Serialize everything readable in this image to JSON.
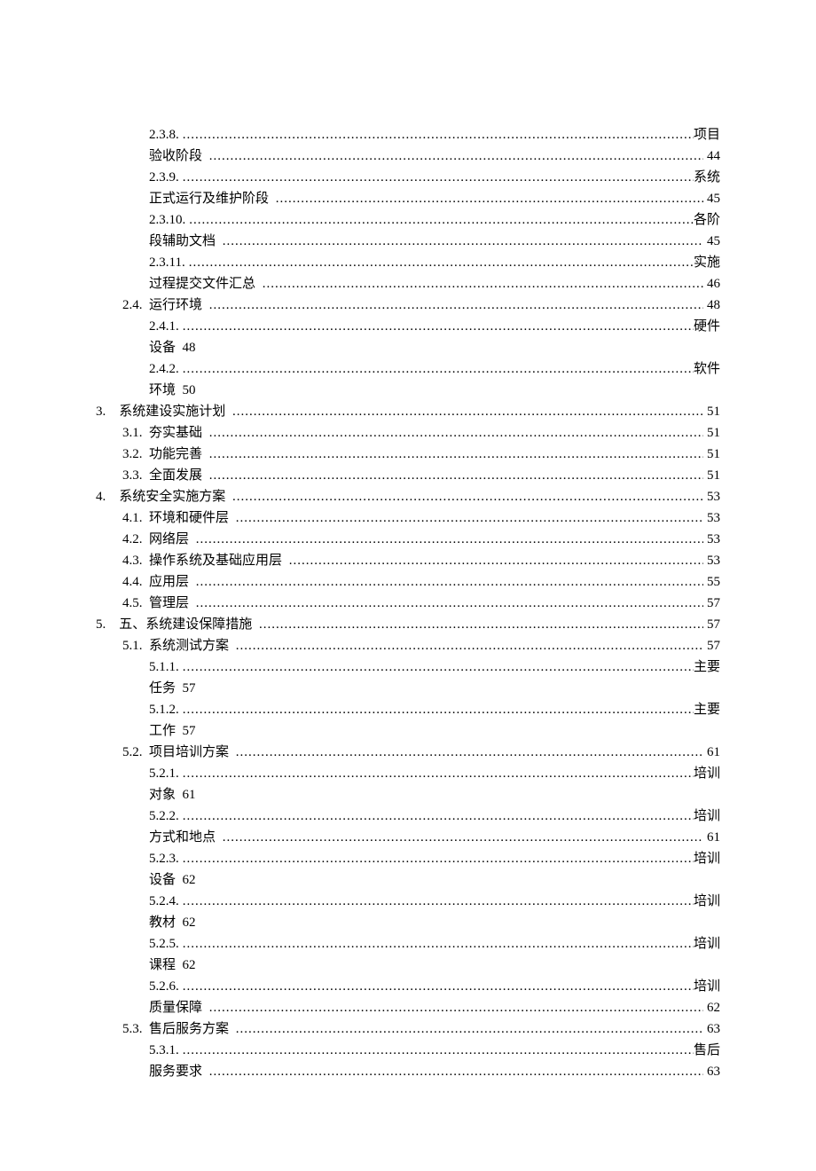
{
  "toc": [
    {
      "kind": "wrap-dots-page",
      "level": 3,
      "num": "2.3.8.",
      "title_tail": "项目",
      "cont": "验收阶段 ",
      "page": "44"
    },
    {
      "kind": "wrap-dots-page",
      "level": 3,
      "num": "2.3.9.",
      "title_tail": "系统",
      "cont": "正式运行及维护阶段 ",
      "page": "45"
    },
    {
      "kind": "wrap-dots-page",
      "level": 3,
      "num": "2.3.10.",
      "title_tail": "各阶",
      "cont": "段辅助文档 ",
      "page": "45"
    },
    {
      "kind": "wrap-dots-page",
      "level": 3,
      "num": "2.3.11.",
      "title_tail": "实施",
      "cont": "过程提交文件汇总 ",
      "page": "46"
    },
    {
      "kind": "single",
      "level": 2,
      "num": "2.4.  ",
      "title": "运行环境 ",
      "page": "48"
    },
    {
      "kind": "wrap-page-only",
      "level": 3,
      "num": "2.4.1.",
      "title_tail": "硬件",
      "cont_text": "设备  48"
    },
    {
      "kind": "wrap-page-only",
      "level": 3,
      "num": "2.4.2.",
      "title_tail": "软件",
      "cont_text": "环境  50"
    },
    {
      "kind": "single",
      "level": 1,
      "num": "3.    ",
      "title": "系统建设实施计划 ",
      "page": "51"
    },
    {
      "kind": "single",
      "level": 2,
      "num": "3.1.  ",
      "title": "夯实基础 ",
      "page": "51"
    },
    {
      "kind": "single",
      "level": 2,
      "num": "3.2.  ",
      "title": "功能完善 ",
      "page": "51"
    },
    {
      "kind": "single",
      "level": 2,
      "num": "3.3.  ",
      "title": "全面发展 ",
      "page": "51"
    },
    {
      "kind": "single",
      "level": 1,
      "num": "4.    ",
      "title": "系统安全实施方案 ",
      "page": "53"
    },
    {
      "kind": "single",
      "level": 2,
      "num": "4.1.  ",
      "title": "环境和硬件层 ",
      "page": "53"
    },
    {
      "kind": "single",
      "level": 2,
      "num": "4.2.  ",
      "title": "网络层 ",
      "page": "53"
    },
    {
      "kind": "single",
      "level": 2,
      "num": "4.3.  ",
      "title": "操作系统及基础应用层 ",
      "page": "53"
    },
    {
      "kind": "single",
      "level": 2,
      "num": "4.4.  ",
      "title": "应用层 ",
      "page": "55"
    },
    {
      "kind": "single",
      "level": 2,
      "num": "4.5.  ",
      "title": "管理层 ",
      "page": "57"
    },
    {
      "kind": "single",
      "level": 1,
      "num": "5.    ",
      "title": "五、系统建设保障措施 ",
      "page": "57"
    },
    {
      "kind": "single",
      "level": 2,
      "num": "5.1.  ",
      "title": "系统测试方案 ",
      "page": "57"
    },
    {
      "kind": "wrap-page-only",
      "level": 3,
      "num": "5.1.1.",
      "title_tail": "主要",
      "cont_text": "任务  57"
    },
    {
      "kind": "wrap-page-only",
      "level": 3,
      "num": "5.1.2.",
      "title_tail": "主要",
      "cont_text": "工作  57"
    },
    {
      "kind": "single",
      "level": 2,
      "num": "5.2.  ",
      "title": "项目培训方案 ",
      "page": "61"
    },
    {
      "kind": "wrap-page-only",
      "level": 3,
      "num": "5.2.1.",
      "title_tail": "培训",
      "cont_text": "对象  61"
    },
    {
      "kind": "wrap-dots-page",
      "level": 3,
      "num": "5.2.2.",
      "title_tail": "培训",
      "cont": "方式和地点 ",
      "page": "61"
    },
    {
      "kind": "wrap-page-only",
      "level": 3,
      "num": "5.2.3.",
      "title_tail": "培训",
      "cont_text": "设备  62"
    },
    {
      "kind": "wrap-page-only",
      "level": 3,
      "num": "5.2.4.",
      "title_tail": "培训",
      "cont_text": "教材  62"
    },
    {
      "kind": "wrap-page-only",
      "level": 3,
      "num": "5.2.5.",
      "title_tail": "培训",
      "cont_text": "课程  62"
    },
    {
      "kind": "wrap-dots-page",
      "level": 3,
      "num": "5.2.6.",
      "title_tail": "培训",
      "cont": "质量保障 ",
      "page": "62"
    },
    {
      "kind": "single",
      "level": 2,
      "num": "5.3.  ",
      "title": "售后服务方案 ",
      "page": "63"
    },
    {
      "kind": "wrap-dots-page",
      "level": 3,
      "num": "5.3.1.",
      "title_tail": "售后",
      "cont": "服务要求 ",
      "page": "63"
    }
  ]
}
